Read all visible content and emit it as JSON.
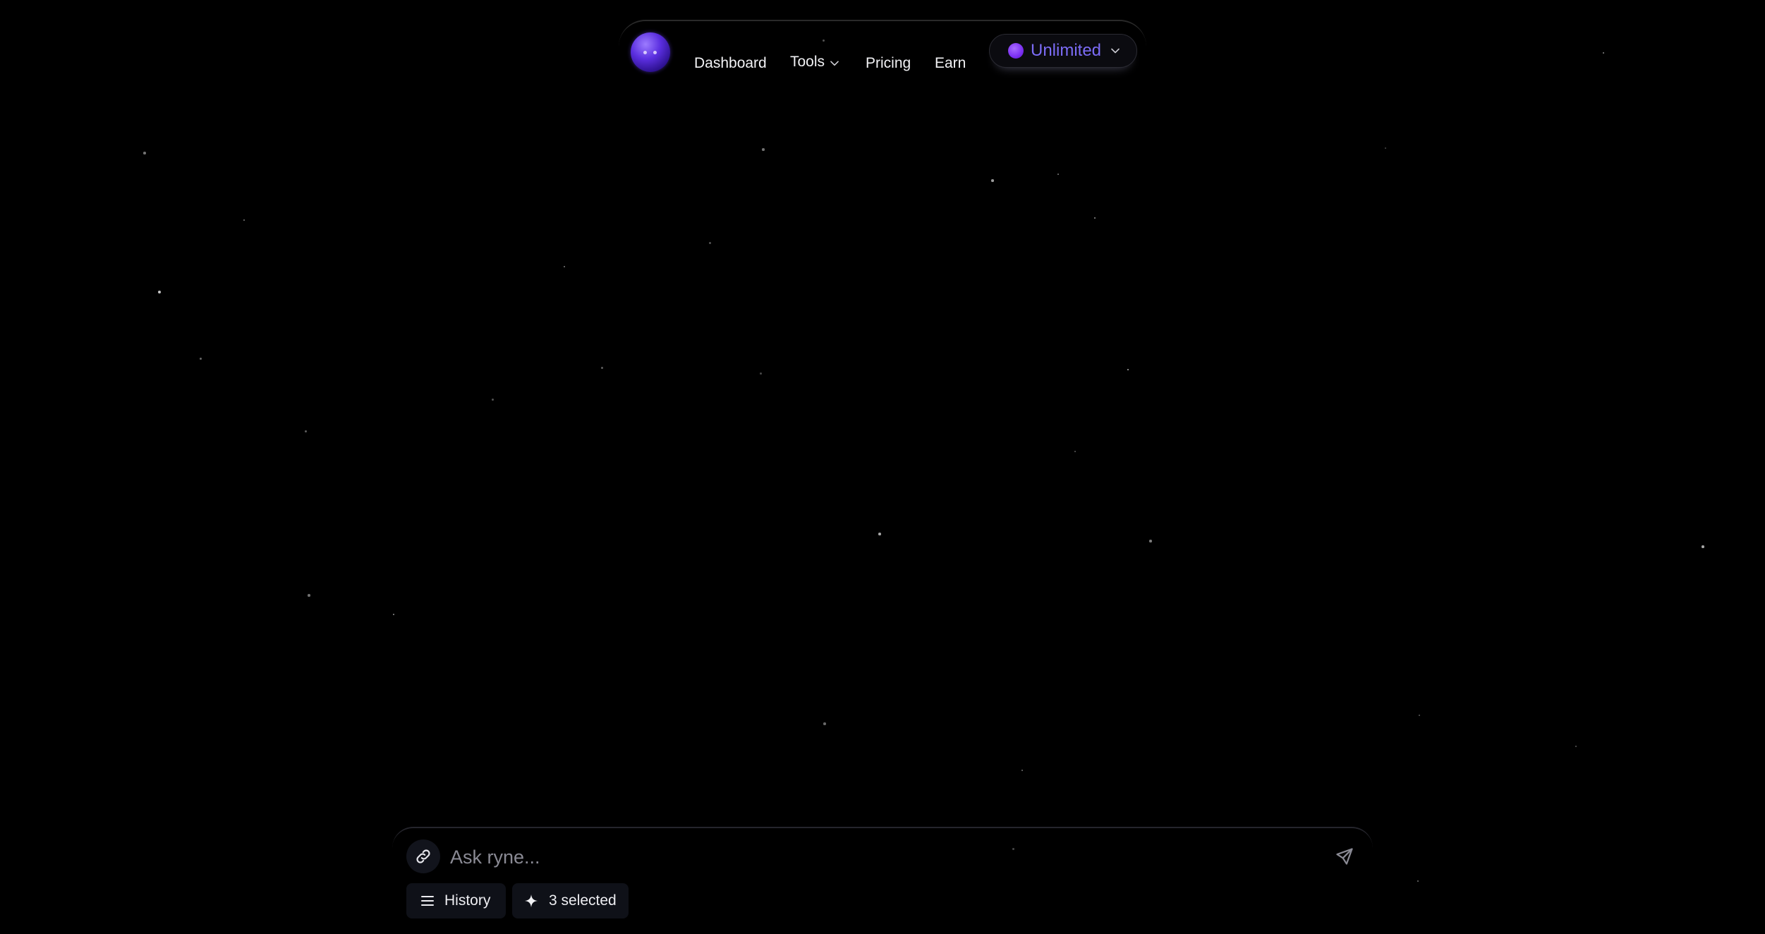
{
  "nav": {
    "logo_name": "ryne-avatar",
    "links": {
      "dashboard": "Dashboard",
      "tools": "Tools",
      "pricing": "Pricing",
      "earn": "Earn"
    },
    "plan": {
      "label": "Unlimited",
      "accent_color": "#7c6cf6"
    }
  },
  "composer": {
    "placeholder": "Ask ryne...",
    "value": "",
    "history_label": "History",
    "selected_label": "3 selected"
  },
  "icons": {
    "attach": "link-icon",
    "send": "send-icon",
    "history": "menu-icon",
    "selected": "sparkle-icon",
    "dropdown": "chevron-down-icon"
  },
  "colors": {
    "background": "#000000",
    "text": "#f2f2f5",
    "pill_bg": "#0f1118",
    "plan_accent": "#7c6cf6",
    "plan_dot": "#7b2ff2"
  }
}
